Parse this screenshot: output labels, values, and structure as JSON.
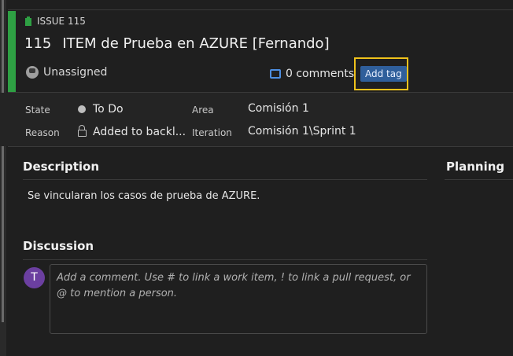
{
  "issue": {
    "type_label": "ISSUE 115",
    "id": "115",
    "title": "ITEM de Prueba en AZURE [Fernando]",
    "assignee": "Unassigned",
    "comments_count": "0 comments",
    "add_tag_label": "Add tag"
  },
  "fields": {
    "state_label": "State",
    "state_value": "To Do",
    "reason_label": "Reason",
    "reason_value": "Added to backl...",
    "area_label": "Area",
    "area_value": "Comisión 1",
    "iteration_label": "Iteration",
    "iteration_value": "Comisión 1\\Sprint 1"
  },
  "description": {
    "title": "Description",
    "text": "Se vincularan los casos de prueba de AZURE."
  },
  "planning": {
    "title": "Planning"
  },
  "discussion": {
    "title": "Discussion",
    "avatar_initial": "T",
    "placeholder": "Add a comment. Use # to link a work item, ! to link a pull request, or @ to mention a person."
  },
  "colors": {
    "accent_green": "#2ea043",
    "focus_yellow": "#f0c21b",
    "tag_blue": "#2f5f9b",
    "avatar_purple": "#6b3fa0"
  }
}
